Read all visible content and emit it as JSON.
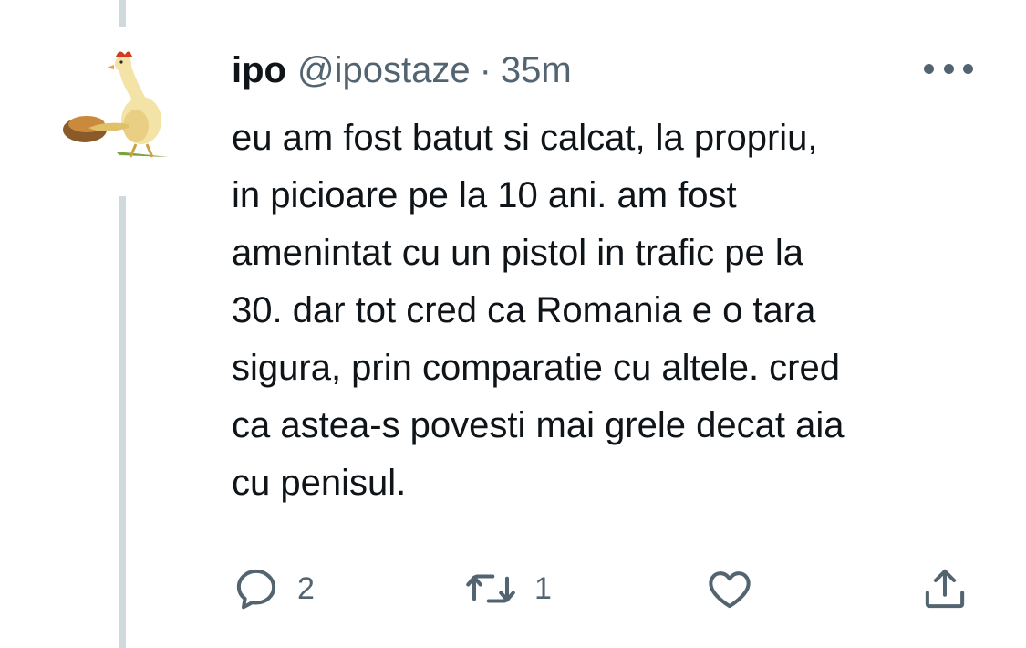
{
  "tweet": {
    "display_name": "ipo",
    "handle": "@ipostaze",
    "separator": "·",
    "time": "35m",
    "text_lines": [
      "eu am fost batut si calcat, la propriu,",
      "in picioare pe la 10 ani. am fost",
      "amenintat cu un pistol in trafic pe la",
      "30. dar tot cred ca Romania e o tara",
      "sigura, prin comparatie cu altele. cred",
      "ca astea-s povesti mai grele decat aia",
      "cu penisul."
    ]
  },
  "actions": {
    "reply_count": "2",
    "retweet_count": "1"
  },
  "icons": {
    "more": "more-horizontal-icon",
    "reply": "reply-bubble-icon",
    "retweet": "retweet-icon",
    "like": "heart-icon",
    "share": "share-upload-icon"
  },
  "colors": {
    "text": "#0f1419",
    "secondary": "#536471",
    "thread_line": "#cfd9de"
  }
}
